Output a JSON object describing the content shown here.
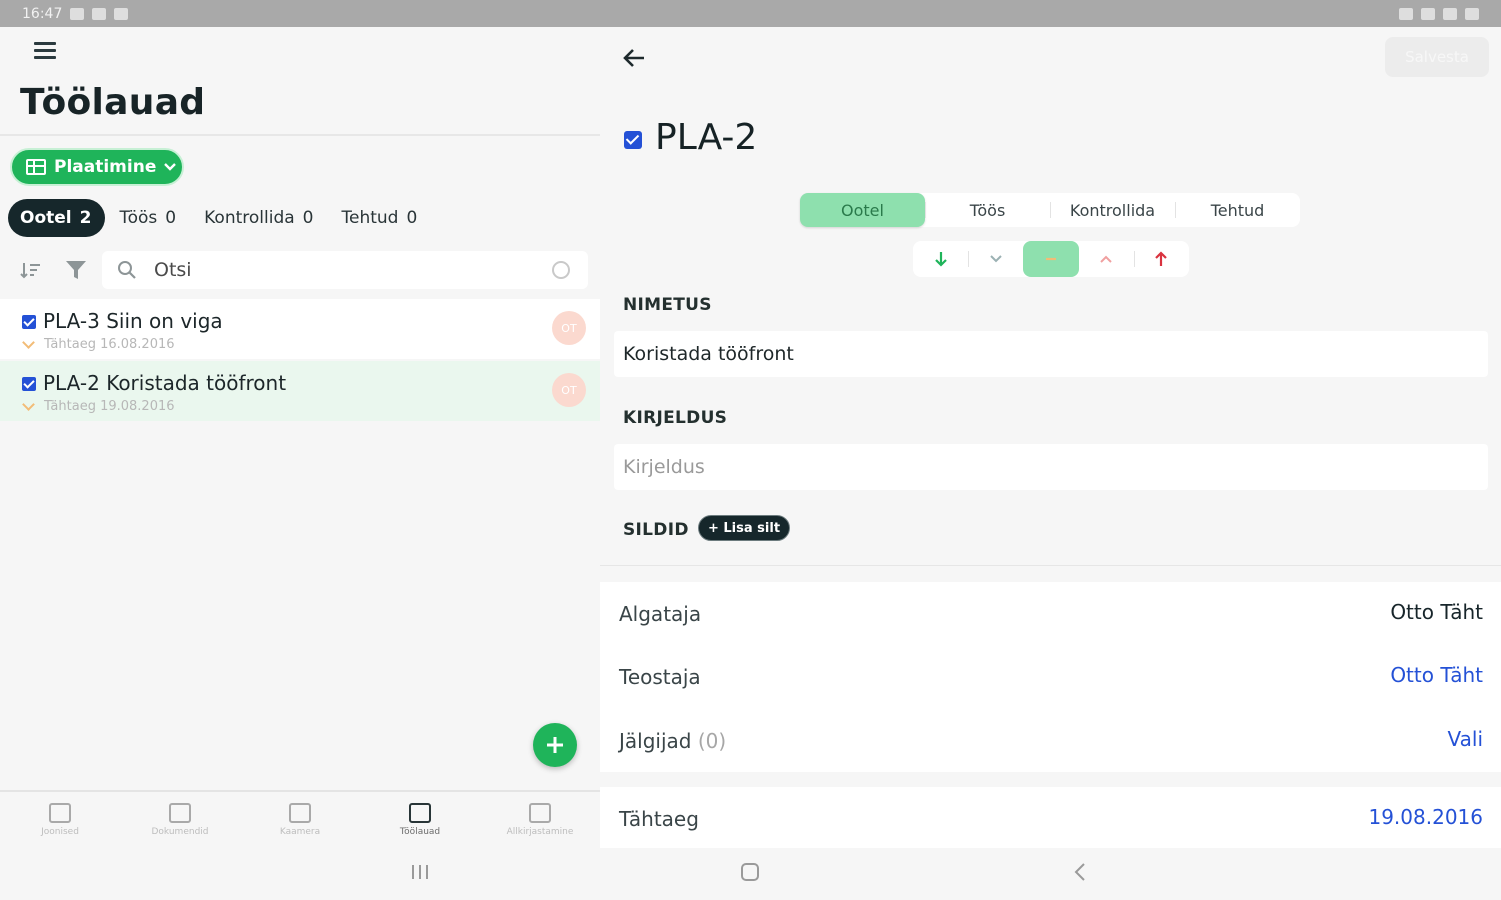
{
  "status_bar": {
    "time": "16:47"
  },
  "left": {
    "title": "Töölauad",
    "board_button": "Plaatimine",
    "status_tabs": [
      {
        "label": "Ootel",
        "count": "2",
        "active": true
      },
      {
        "label": "Töös",
        "count": "0",
        "active": false
      },
      {
        "label": "Kontrollida",
        "count": "0",
        "active": false
      },
      {
        "label": "Tehtud",
        "count": "0",
        "active": false
      }
    ],
    "search": {
      "placeholder": "Otsi",
      "value": ""
    },
    "tasks": [
      {
        "title": "PLA-3 Siin on viga",
        "meta": "Tähtaeg 16.08.2016",
        "selected": false,
        "avatar": "OT"
      },
      {
        "title": "PLA-2 Koristada tööfront",
        "meta": "Tähtaeg 19.08.2016",
        "selected": true,
        "avatar": "OT"
      }
    ],
    "bottom_nav": [
      {
        "label": "Joonised",
        "icon": "drawing-icon"
      },
      {
        "label": "Dokumendid",
        "icon": "documents-icon"
      },
      {
        "label": "Kaamera",
        "icon": "camera-icon"
      },
      {
        "label": "Töölauad",
        "icon": "board-icon",
        "active": true
      },
      {
        "label": "Allkirjastamine",
        "icon": "signature-icon"
      }
    ]
  },
  "right": {
    "save_label": "Salvesta",
    "issue_key": "PLA-2",
    "status_segments": [
      "Ootel",
      "Töös",
      "Kontrollida",
      "Tehtud"
    ],
    "active_status": "Ootel",
    "sections": {
      "name_label": "NIMETUS",
      "name_value": "Koristada tööfront",
      "description_label": "KIRJELDUS",
      "description_placeholder": "Kirjeldus",
      "tags_label": "SILDID",
      "add_tag": "+ Lisa silt"
    },
    "people": {
      "creator_label": "Algataja",
      "creator_value": "Otto Täht",
      "assignee_label": "Teostaja",
      "assignee_value": "Otto Täht",
      "followers_label": "Jälgijad",
      "followers_count": "(0)",
      "followers_value": "Vali"
    },
    "deadline_label": "Tähtaeg",
    "deadline_value": "19.08.2016"
  },
  "colors": {
    "accent_green": "#1fb45a",
    "active_segment": "#8ee0ae",
    "link_blue": "#2451d6",
    "dark": "#16272b"
  }
}
